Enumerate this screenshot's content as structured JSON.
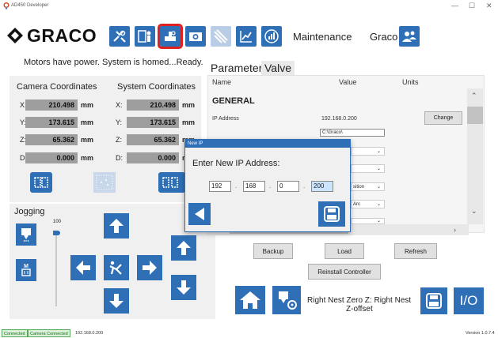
{
  "window": {
    "title": "AD450 Developer",
    "controls": {
      "minimize": "—",
      "maximize": "☐",
      "close": "✕"
    }
  },
  "header": {
    "brand": "GRACO",
    "nav_icons": [
      "maintenance-tools-icon",
      "user-panel-icon",
      "recipe-editor-icon",
      "camera-icon",
      "material-dispense-icon",
      "chart-icon",
      "volume-icon"
    ],
    "maintenance_label": "Maintenance",
    "user_name": "Graco"
  },
  "status": {
    "message": "Motors have power. System is homed...Ready."
  },
  "coordinates": {
    "camera_header": "Camera Coordinates",
    "system_header": "System Coordinates",
    "rows": [
      {
        "axis": "X:",
        "camera": "210.498",
        "system": "210.498",
        "unit": "mm"
      },
      {
        "axis": "Y:",
        "camera": "173.615",
        "system": "173.615",
        "unit": "mm"
      },
      {
        "axis": "Z:",
        "camera": "65.362",
        "system": "65.362",
        "unit": "mm"
      },
      {
        "axis": "D:",
        "camera": "0.000",
        "system": "0.000",
        "unit": "mm"
      }
    ]
  },
  "jogging": {
    "title": "Jogging",
    "speed_value": "100",
    "speed_fraction": 1.0
  },
  "tabs": [
    {
      "label": "Parameters",
      "active": true
    },
    {
      "label": "Valve",
      "active": false
    }
  ],
  "parameters": {
    "columns": {
      "name": "Name",
      "value": "Value",
      "units": "Units"
    },
    "section": "GENERAL",
    "ip_label": "IP Address",
    "ip_value": "192.168.0.200",
    "path_value": "C:\\Graco\\",
    "change_button": "Change",
    "combo_fragment_1": "sition",
    "combo_fragment_2": "Arc",
    "scroll_right_icon": "›",
    "backup_button": "Backup",
    "load_button": "Load",
    "refresh_button": "Refresh",
    "reinstall_button": "Reinstall Controller"
  },
  "dialog": {
    "title": "New IP",
    "prompt": "Enter New IP Address:",
    "octets": [
      "192",
      "168",
      "0",
      "200"
    ],
    "separator": "."
  },
  "footer": {
    "nest_text_line1": "Right Nest Zero Z: Right Nest",
    "nest_text_line2": "Z-offset",
    "io_label": "I/O"
  },
  "statusbar": {
    "connected": "Connected",
    "camera_connected": "Camera Connected",
    "ip": "192.168.0.200",
    "version": "Version 1.0.7.4"
  },
  "colors": {
    "accent_blue": "#2f6fb6",
    "selection_red": "#e0201f",
    "value_gray": "#9e9e9e",
    "status_green": "#57a957"
  }
}
